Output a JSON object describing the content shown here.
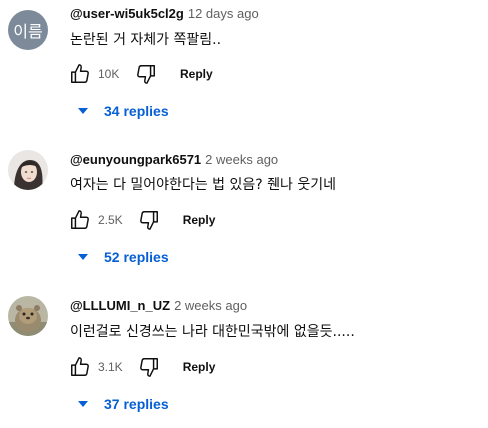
{
  "comments": [
    {
      "avatar_initials": "이름",
      "author": "@user-wi5uk5cl2g",
      "time": "12 days ago",
      "text": "논란된 거 자체가 쪽팔림..",
      "likes": "10K",
      "reply_label": "Reply",
      "replies_label": "34 replies"
    },
    {
      "author": "@eunyoungpark6571",
      "time": "2 weeks ago",
      "text": "여자는 다 밀어야한다는 법 있음? 줸나 웃기네",
      "likes": "2.5K",
      "reply_label": "Reply",
      "replies_label": "52 replies"
    },
    {
      "author": "@LLLUMI_n_UZ",
      "time": "2 weeks ago",
      "text": "이런걸로 신경쓰는 나라 대한민국밖에 없을듯.....",
      "likes": "3.1K",
      "reply_label": "Reply",
      "replies_label": "37 replies"
    }
  ],
  "colors": {
    "link_blue": "#065fd4",
    "secondary_text": "#606060",
    "avatar_gray": "#7c8a9a"
  },
  "icons": {
    "like": "thumbs-up-icon",
    "dislike": "thumbs-down-icon",
    "expand": "caret-down-icon"
  }
}
